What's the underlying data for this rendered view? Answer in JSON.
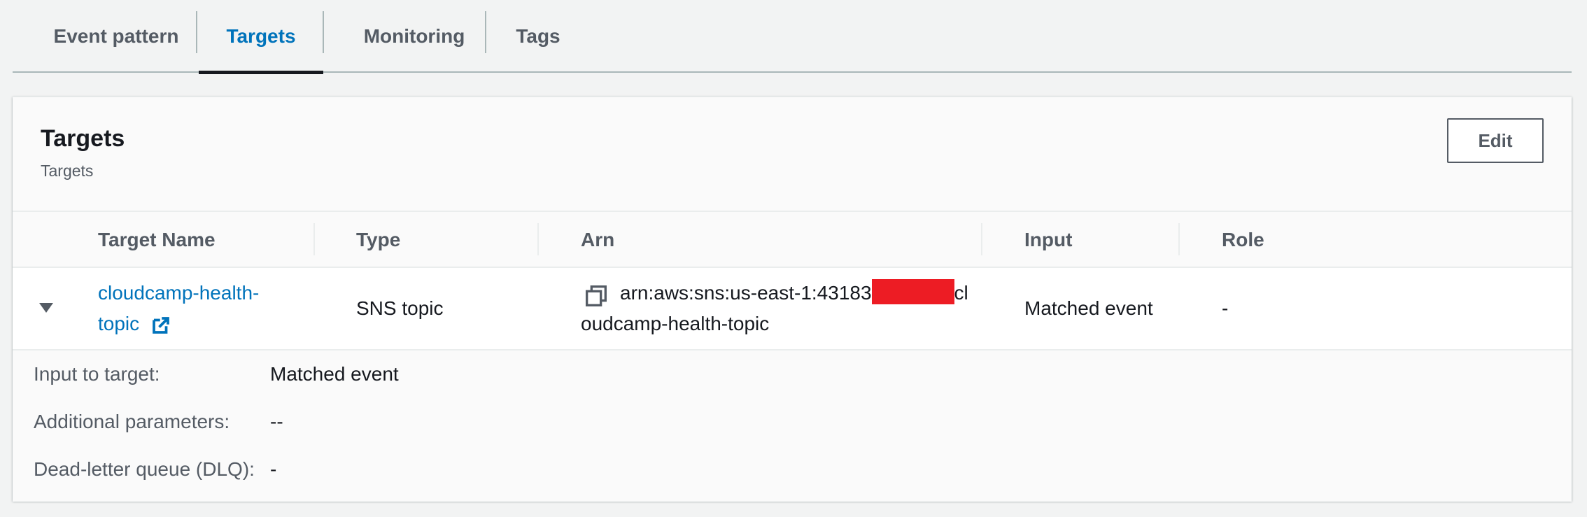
{
  "tabs": [
    {
      "label": "Event pattern",
      "active": false
    },
    {
      "label": "Targets",
      "active": true
    },
    {
      "label": "Monitoring",
      "active": false
    },
    {
      "label": "Tags",
      "active": false
    }
  ],
  "panel": {
    "title": "Targets",
    "subtitle": "Targets",
    "edit_label": "Edit"
  },
  "table": {
    "columns": [
      "Target Name",
      "Type",
      "Arn",
      "Input",
      "Role"
    ],
    "row": {
      "target_name_line1": "cloudcamp-health-",
      "target_name_line2": "topic",
      "type": "SNS topic",
      "arn_line1_prefix": "arn:aws:sns:us-east-1:43183",
      "arn_line1_suffix": "cl",
      "arn_line2": "oudcamp-health-topic",
      "input": "Matched event",
      "role": "-"
    }
  },
  "details": [
    {
      "label": "Input to target:",
      "value": "Matched event"
    },
    {
      "label": "Additional parameters:",
      "value": "--"
    },
    {
      "label": "Dead-letter queue (DLQ):",
      "value": "-"
    }
  ],
  "colors": {
    "accent": "#0073bb",
    "redaction": "#ed1c24"
  },
  "icons": {
    "expand": "caret-down-icon",
    "external": "external-link-icon",
    "copy": "copy-icon"
  }
}
